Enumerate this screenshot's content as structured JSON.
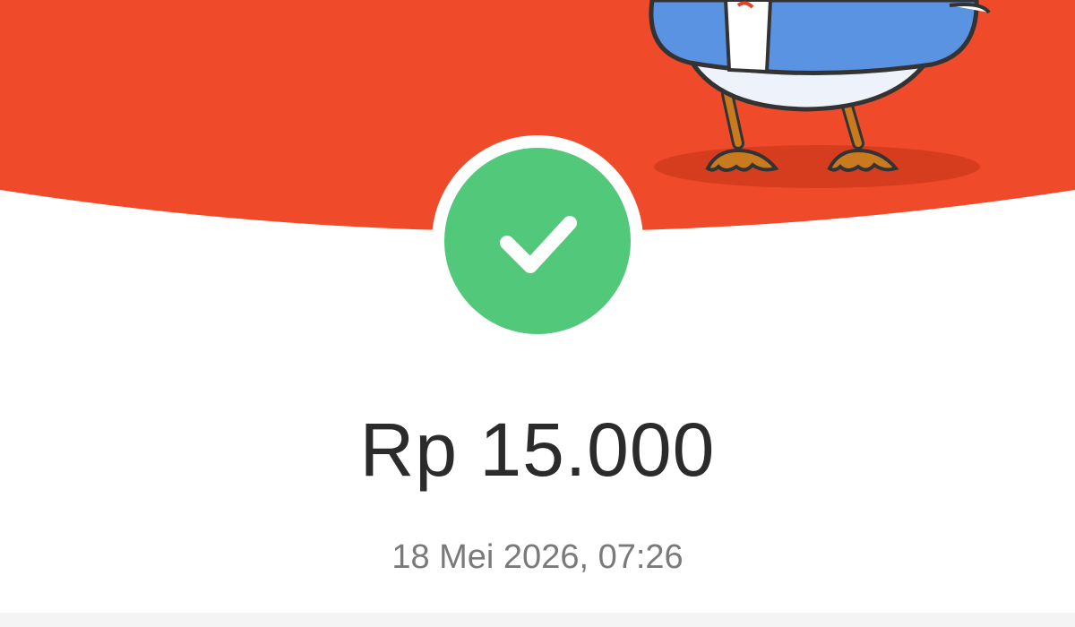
{
  "theme": {
    "header_color": "#ef4b2b",
    "success_color": "#52c97a",
    "mascot_body_color": "#5b93e3"
  },
  "status": {
    "icon": "check-icon",
    "state": "success"
  },
  "transaction": {
    "amount": "Rp 15.000",
    "datetime": "18 Mei 2026, 07:26"
  }
}
